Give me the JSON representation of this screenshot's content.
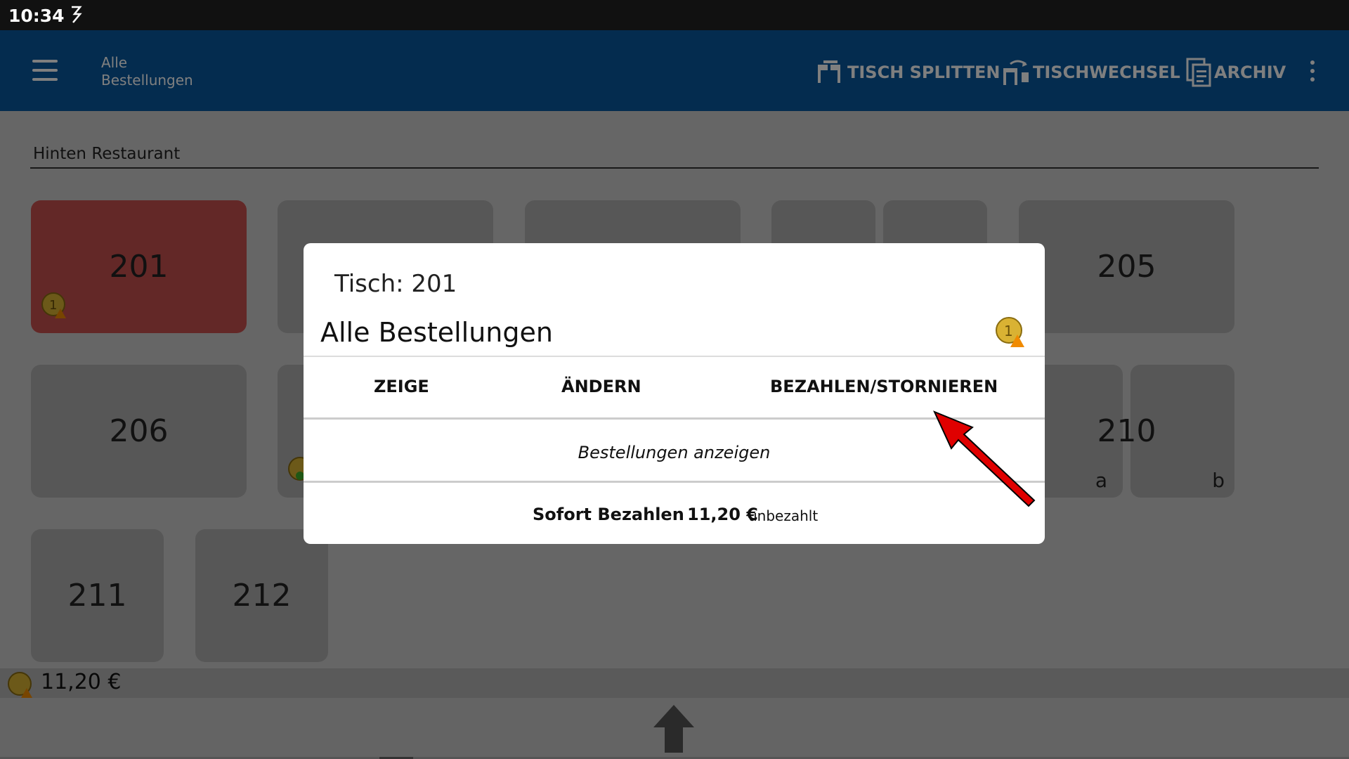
{
  "status_bar": {
    "time": "10:34"
  },
  "app_bar": {
    "title_line1": "Alle",
    "title_line2": "Bestellungen",
    "actions": [
      {
        "label": "TISCH SPLITTEN",
        "icon": "table-split-icon"
      },
      {
        "label": "TISCHWECHSEL",
        "icon": "table-change-icon"
      },
      {
        "label": "ARCHIV",
        "icon": "archive-icon"
      }
    ]
  },
  "room": {
    "name": "Hinten Restaurant"
  },
  "tables": [
    {
      "label": "201",
      "status": "occupied"
    },
    {
      "label": "205"
    },
    {
      "label": "206"
    },
    {
      "label": "210",
      "sub": [
        "a",
        "b"
      ]
    },
    {
      "label": "211"
    },
    {
      "label": "212"
    }
  ],
  "total_bar": {
    "amount": "11,20 €"
  },
  "dialog": {
    "title": "Tisch: 201",
    "subtitle": "Alle Bestellungen",
    "buttons": {
      "show": "ZEIGE",
      "change": "ÄNDERN",
      "pay_cancel": "BEZAHLEN/STORNIEREN"
    },
    "show_orders": "Bestellungen anzeigen",
    "pay_now_label": "Sofort Bezahlen",
    "pay_amount": "11,20 €",
    "pay_status": "unbezahlt"
  },
  "colors": {
    "app_bar": "#08599f",
    "occupied": "#c7504f",
    "annotation_arrow": "#e00000"
  }
}
